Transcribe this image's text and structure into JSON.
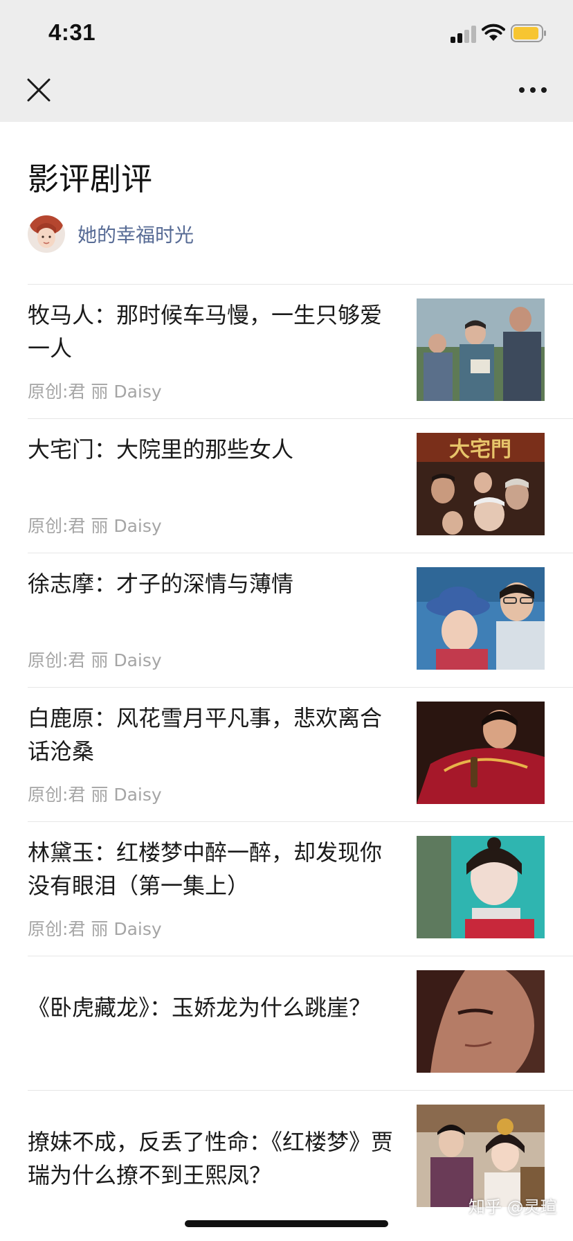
{
  "status_bar": {
    "time": "4:31",
    "battery_color": "#f7c531"
  },
  "header": {
    "close_icon": "close-icon",
    "more_icon": "more-horizontal-icon"
  },
  "page": {
    "title": "影评剧评",
    "author": "她的幸福时光",
    "author_color": "#576b95"
  },
  "articles": [
    {
      "title": "牧马人：那时候车马慢，一生只够爱一人",
      "source": "原创:君 丽 Daisy"
    },
    {
      "title": "大宅门：大院里的那些女人",
      "source": "原创:君 丽 Daisy",
      "thumb_text": "大宅門"
    },
    {
      "title": "徐志摩：才子的深情与薄情",
      "source": "原创:君 丽 Daisy"
    },
    {
      "title": "白鹿原：风花雪月平凡事，悲欢离合话沧桑",
      "source": "原创:君 丽 Daisy"
    },
    {
      "title": "林黛玉：红楼梦中醉一醉，却发现你没有眼泪（第一集上）",
      "source": "原创:君 丽 Daisy"
    },
    {
      "title": "《卧虎藏龙》：玉娇龙为什么跳崖？",
      "source": ""
    },
    {
      "title": "撩妹不成，反丢了性命：《红楼梦》贾瑞为什么撩不到王熙凤？",
      "source": ""
    }
  ],
  "watermark": "知乎 @灵瑄"
}
